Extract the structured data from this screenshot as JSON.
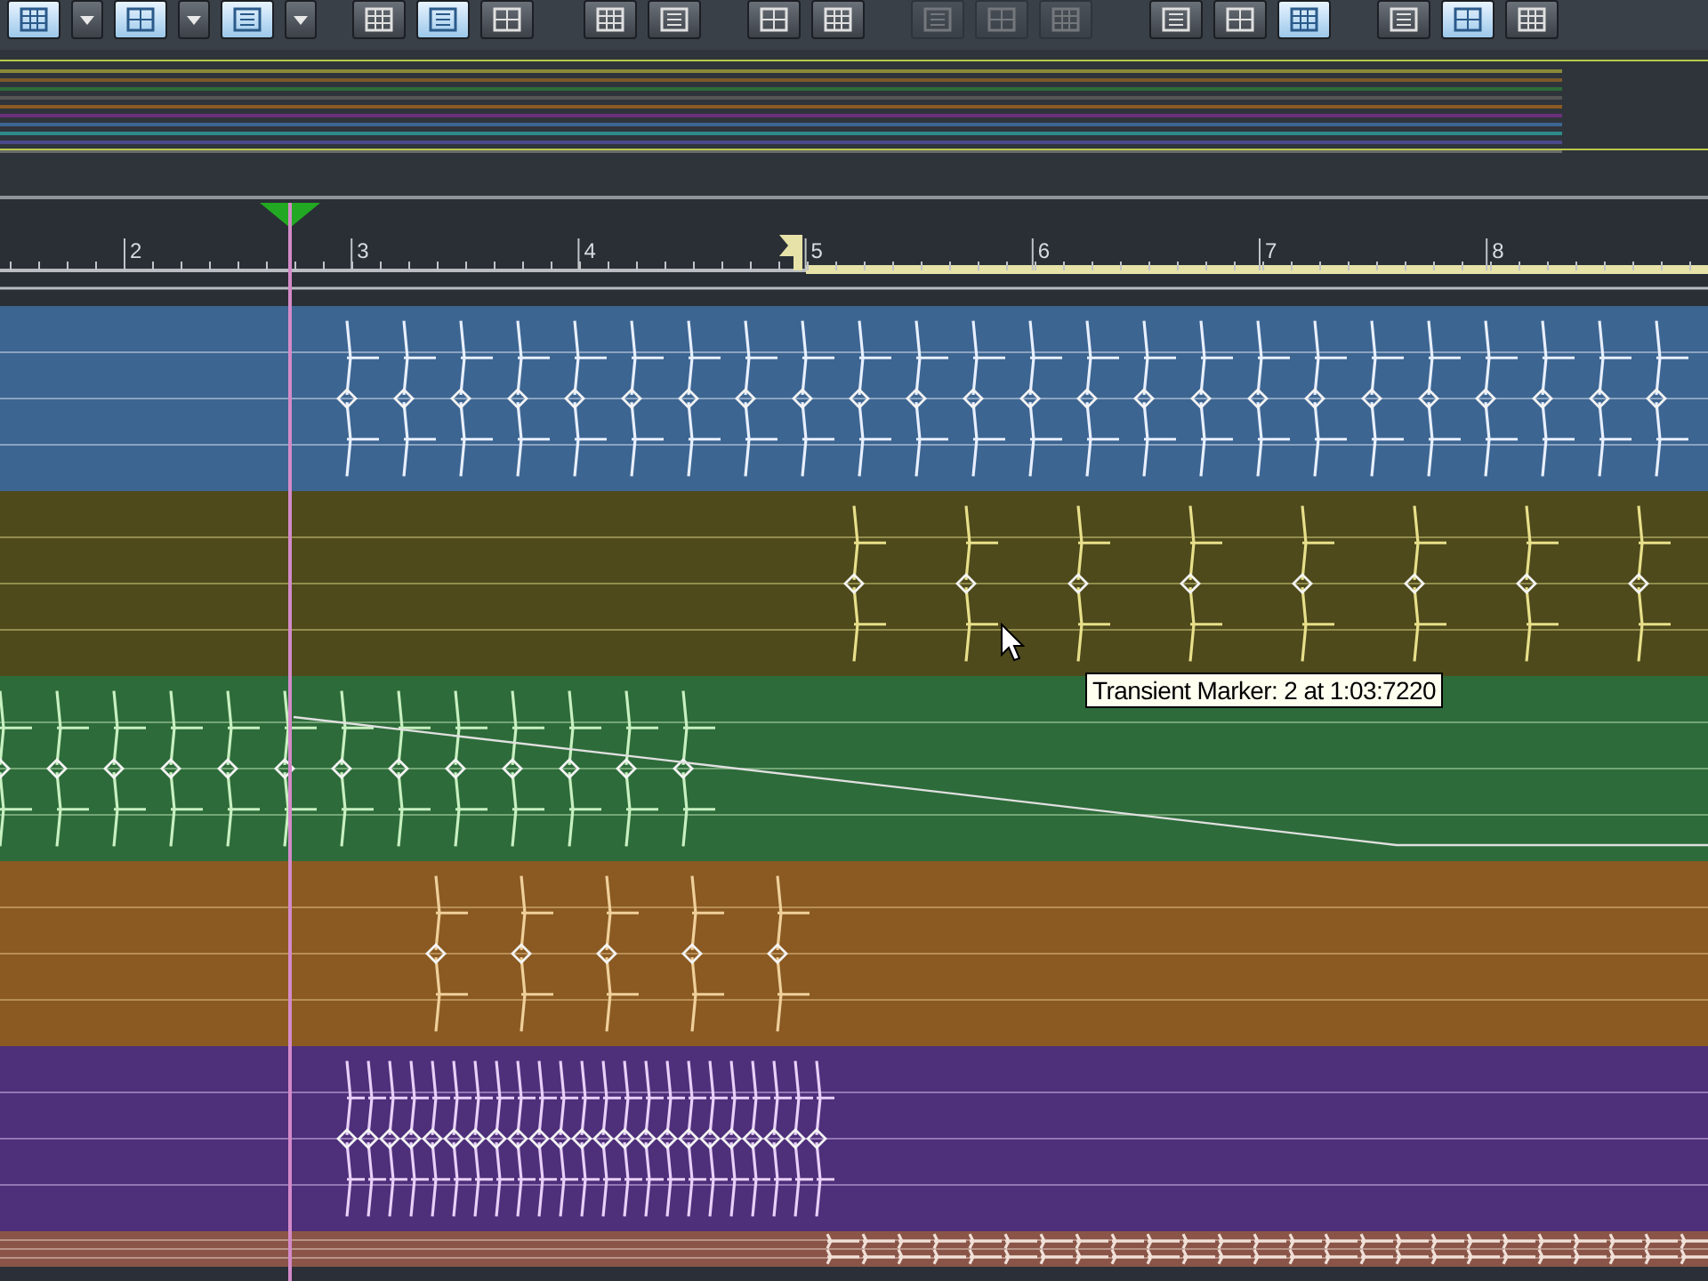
{
  "toolbar": [
    {
      "kind": "tool",
      "selected": true,
      "disabled": false
    },
    {
      "kind": "dropdown",
      "selected": false,
      "disabled": false
    },
    {
      "kind": "tool",
      "selected": true,
      "disabled": false
    },
    {
      "kind": "dropdown",
      "selected": false,
      "disabled": false
    },
    {
      "kind": "tool",
      "selected": true,
      "disabled": false
    },
    {
      "kind": "dropdown",
      "selected": false,
      "disabled": false
    },
    {
      "kind": "tool",
      "selected": false,
      "disabled": false
    },
    {
      "kind": "tool",
      "selected": true,
      "disabled": false
    },
    {
      "kind": "tool",
      "selected": false,
      "disabled": false
    },
    {
      "kind": "tool",
      "selected": false,
      "disabled": false
    },
    {
      "kind": "tool",
      "selected": false,
      "disabled": false
    },
    {
      "kind": "tool",
      "selected": false,
      "disabled": false
    },
    {
      "kind": "tool",
      "selected": false,
      "disabled": false
    },
    {
      "kind": "tool",
      "selected": false,
      "disabled": true
    },
    {
      "kind": "tool",
      "selected": false,
      "disabled": true
    },
    {
      "kind": "tool",
      "selected": false,
      "disabled": true
    },
    {
      "kind": "tool",
      "selected": false,
      "disabled": false
    },
    {
      "kind": "tool",
      "selected": false,
      "disabled": false
    },
    {
      "kind": "tool",
      "selected": true,
      "disabled": false
    },
    {
      "kind": "tool",
      "selected": false,
      "disabled": false
    },
    {
      "kind": "tool",
      "selected": true,
      "disabled": false
    },
    {
      "kind": "tool",
      "selected": false,
      "disabled": false
    }
  ],
  "ruler": {
    "labels": [
      "2",
      "3",
      "4",
      "5",
      "6",
      "7",
      "8"
    ]
  },
  "tracks": [
    {
      "color": "#3d6591"
    },
    {
      "color": "#4e4a1c"
    },
    {
      "color": "#2e6b3a"
    },
    {
      "color": "#8a5a22"
    },
    {
      "color": "#4e2f7a"
    },
    {
      "color": "#8a5548"
    }
  ],
  "tooltip": {
    "text": "Transient Marker: 2 at 1:03:7220"
  }
}
